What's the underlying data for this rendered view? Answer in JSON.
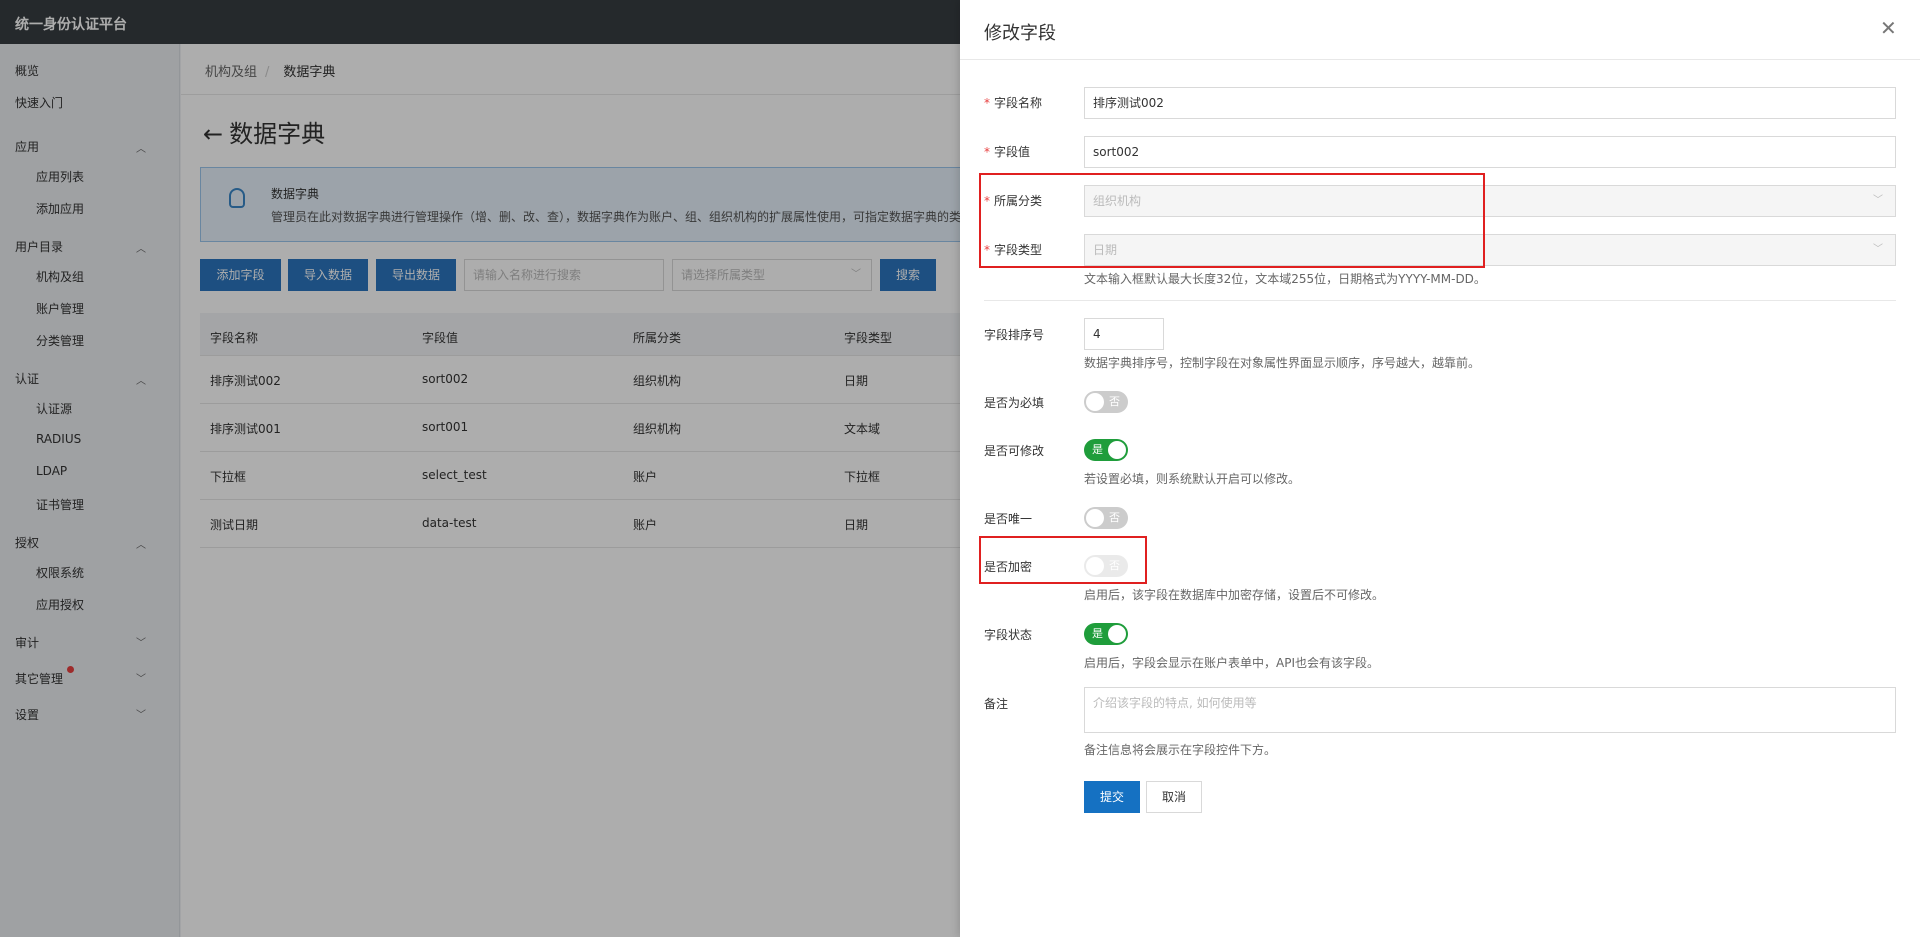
{
  "app": {
    "title": "统一身份认证平台"
  },
  "sidebar": {
    "items": [
      {
        "label": "概览",
        "sub": false
      },
      {
        "label": "快速入门",
        "sub": false
      },
      {
        "label": "应用",
        "sub": false,
        "expanded": true
      },
      {
        "label": "应用列表",
        "sub": true
      },
      {
        "label": "添加应用",
        "sub": true
      },
      {
        "label": "用户目录",
        "sub": false,
        "expanded": true
      },
      {
        "label": "机构及组",
        "sub": true
      },
      {
        "label": "账户管理",
        "sub": true
      },
      {
        "label": "分类管理",
        "sub": true
      },
      {
        "label": "认证",
        "sub": false,
        "expanded": true
      },
      {
        "label": "认证源",
        "sub": true
      },
      {
        "label": "RADIUS",
        "sub": true
      },
      {
        "label": "LDAP",
        "sub": true
      },
      {
        "label": "证书管理",
        "sub": true
      },
      {
        "label": "授权",
        "sub": false,
        "expanded": true
      },
      {
        "label": "权限系统",
        "sub": true
      },
      {
        "label": "应用授权",
        "sub": true
      },
      {
        "label": "审计",
        "sub": false,
        "expanded": false
      },
      {
        "label": "其它管理",
        "sub": false,
        "expanded": false,
        "badge": true
      },
      {
        "label": "设置",
        "sub": false,
        "expanded": false
      }
    ]
  },
  "breadcrumb": {
    "parent": "机构及组",
    "current": "数据字典"
  },
  "page": {
    "title": "数据字典",
    "back_icon": "arrow-left-icon"
  },
  "tip": {
    "title": "数据字典",
    "desc": "管理员在此对数据字典进行管理操作（增、删、改、查），数据字典作为账户、组、组织机构的扩展属性使用，可指定数据字典的类"
  },
  "toolbar": {
    "add": "添加字段",
    "import": "导入数据",
    "export": "导出数据",
    "search_placeholder": "请输入名称进行搜索",
    "type_placeholder": "请选择所属类型",
    "search": "搜索"
  },
  "table": {
    "headers": [
      "字段名称",
      "字段值",
      "所属分类",
      "字段类型"
    ],
    "rows": [
      [
        "排序测试002",
        "sort002",
        "组织机构",
        "日期"
      ],
      [
        "排序测试001",
        "sort001",
        "组织机构",
        "文本域"
      ],
      [
        "下拉框",
        "select_test",
        "账户",
        "下拉框"
      ],
      [
        "测试日期",
        "data-test",
        "账户",
        "日期"
      ]
    ]
  },
  "drawer": {
    "title": "修改字段",
    "close_icon": "close-icon",
    "name_label": "字段名称",
    "name_value": "排序测试002",
    "value_label": "字段值",
    "value_value": "sort002",
    "category_label": "所属分类",
    "category_value": "组织机构",
    "type_label": "字段类型",
    "type_value": "日期",
    "type_help": "文本输入框默认最大长度32位，文本域255位，日期格式为YYYY-MM-DD。",
    "order_label": "字段排序号",
    "order_value": "4",
    "order_help": "数据字典排序号，控制字段在对象属性界面显示顺序，序号越大，越靠前。",
    "required_label": "是否为必填",
    "required_state": "否",
    "editable_label": "是否可修改",
    "editable_state": "是",
    "editable_help": "若设置必填，则系统默认开启可以修改。",
    "unique_label": "是否唯一",
    "unique_state": "否",
    "encrypt_label": "是否加密",
    "encrypt_state": "否",
    "encrypt_help": "启用后，该字段在数据库中加密存储，设置后不可修改。",
    "status_label": "字段状态",
    "status_state": "是",
    "status_help": "启用后，字段会显示在账户表单中，API也会有该字段。",
    "remark_label": "备注",
    "remark_placeholder": "介绍该字段的特点, 如何使用等",
    "remark_help": "备注信息将会展示在字段控件下方。",
    "submit": "提交",
    "cancel": "取消",
    "required_mark": "*"
  },
  "colors": {
    "primary": "#2b75be",
    "toggle_on": "#1f9d3b",
    "highlight": "#e02020"
  }
}
